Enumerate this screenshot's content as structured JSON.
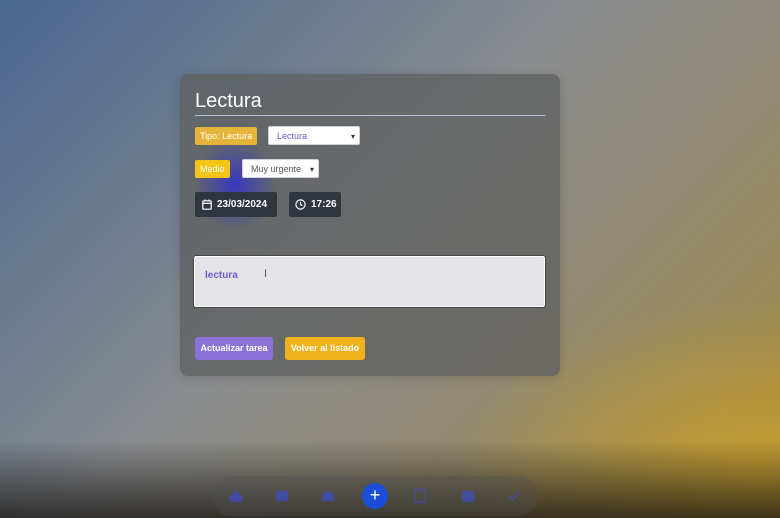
{
  "task": {
    "title": "Lectura",
    "type_badge": "Tipo: Lectura",
    "type_select_value": "Lectura",
    "priority_badge": "Medio",
    "priority_select_value": "Muy urgente",
    "date": "23/03/2024",
    "time": "17:26",
    "description": "lectura"
  },
  "actions": {
    "update_label": "Actualizar tarea",
    "back_label": "Volver al listado"
  },
  "dock": {
    "items": [
      "home-icon",
      "inbox-icon",
      "briefcase-icon",
      "plus-icon",
      "notes-icon",
      "calendar-icon",
      "check-icon"
    ]
  },
  "colors": {
    "accent_purple": "#8b72d8",
    "accent_yellow": "#f0b21a",
    "dock_primary": "#1b4ed8"
  }
}
